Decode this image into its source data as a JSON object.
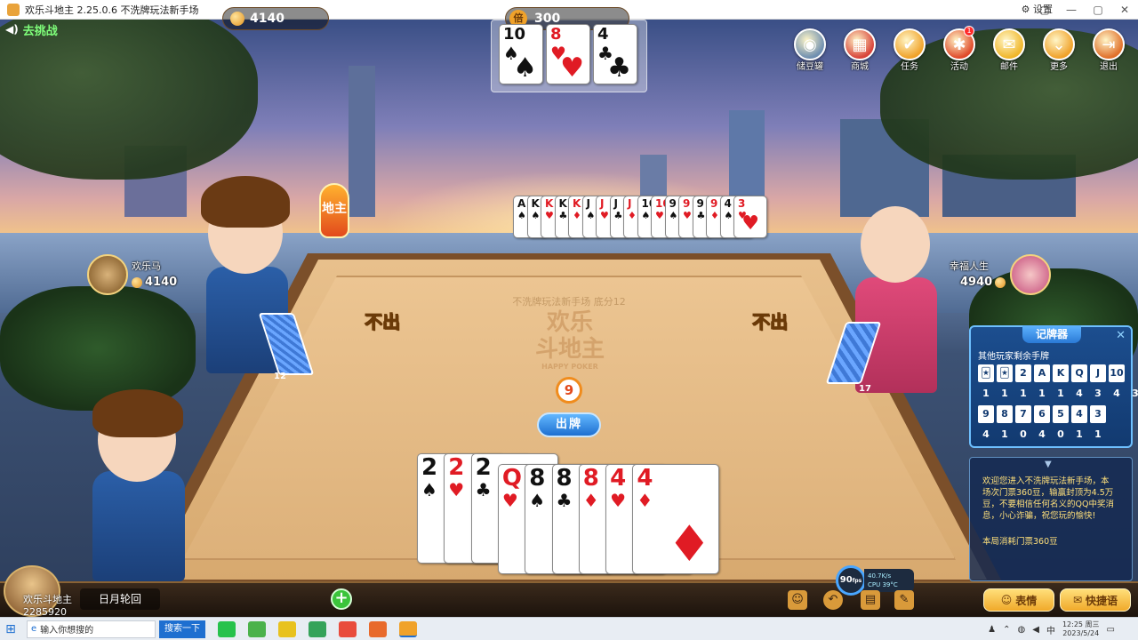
{
  "window": {
    "title": "欢乐斗地主 2.25.0.6 不洗牌玩法新手场",
    "settings_label": "设置",
    "controls": [
      "▢",
      "—",
      "▢",
      "✕"
    ]
  },
  "challenge": {
    "label": "去挑战"
  },
  "bottom_cards": [
    {
      "rank": "10",
      "suit": "♠",
      "color": "black"
    },
    {
      "rank": "8",
      "suit": "♥",
      "color": "red"
    },
    {
      "rank": "4",
      "suit": "♣",
      "color": "black"
    }
  ],
  "top_menu": [
    {
      "label": "储豆罐",
      "icon": "piggy-bank-icon",
      "color": "#6f8fb0",
      "glyph": "◉",
      "badge": ""
    },
    {
      "label": "商城",
      "icon": "shop-icon",
      "color": "#d8443a",
      "glyph": "▦",
      "badge": ""
    },
    {
      "label": "任务",
      "icon": "task-icon",
      "color": "#f0a22a",
      "glyph": "✔",
      "badge": ""
    },
    {
      "label": "活动",
      "icon": "gift-icon",
      "color": "#e04a2a",
      "glyph": "✱",
      "badge": "1"
    },
    {
      "label": "邮件",
      "icon": "mail-icon",
      "color": "#f0b62a",
      "glyph": "✉",
      "badge": ""
    },
    {
      "label": "更多",
      "icon": "more-icon",
      "color": "#f0a22a",
      "glyph": "⌄",
      "badge": ""
    },
    {
      "label": "退出",
      "icon": "exit-icon",
      "color": "#e0702a",
      "glyph": "⇥",
      "badge": ""
    }
  ],
  "left_player": {
    "name": "欢乐马",
    "beans": "4140",
    "card_count": "12",
    "action": "不出",
    "role": "地主"
  },
  "right_player": {
    "name": "幸福人生",
    "beans": "4940",
    "card_count": "17",
    "action": "不出"
  },
  "played_cards": [
    {
      "rank": "A",
      "suit": "♠",
      "color": "black"
    },
    {
      "rank": "K",
      "suit": "♠",
      "color": "black"
    },
    {
      "rank": "K",
      "suit": "♥",
      "color": "red"
    },
    {
      "rank": "K",
      "suit": "♣",
      "color": "black"
    },
    {
      "rank": "K",
      "suit": "♦",
      "color": "red"
    },
    {
      "rank": "J",
      "suit": "♠",
      "color": "black"
    },
    {
      "rank": "J",
      "suit": "♥",
      "color": "red"
    },
    {
      "rank": "J",
      "suit": "♣",
      "color": "black"
    },
    {
      "rank": "J",
      "suit": "♦",
      "color": "red"
    },
    {
      "rank": "10",
      "suit": "♠",
      "color": "black"
    },
    {
      "rank": "10",
      "suit": "♥",
      "color": "red"
    },
    {
      "rank": "9",
      "suit": "♠",
      "color": "black"
    },
    {
      "rank": "9",
      "suit": "♥",
      "color": "red"
    },
    {
      "rank": "9",
      "suit": "♣",
      "color": "black"
    },
    {
      "rank": "9",
      "suit": "♦",
      "color": "red"
    },
    {
      "rank": "4",
      "suit": "♠",
      "color": "black"
    },
    {
      "rank": "3",
      "suit": "♥",
      "color": "red"
    }
  ],
  "table": {
    "info": "不洗牌玩法新手场 底分12",
    "logo_line1": "欢乐",
    "logo_line2": "斗地主",
    "logo_sub": "HAPPY POKER"
  },
  "timer": "9",
  "play_button": "出牌",
  "hand_cards": [
    {
      "rank": "2",
      "suit": "♠",
      "color": "black"
    },
    {
      "rank": "2",
      "suit": "♥",
      "color": "red"
    },
    {
      "rank": "2",
      "suit": "♣",
      "color": "black"
    },
    {
      "rank": "Q",
      "suit": "♥",
      "color": "red"
    },
    {
      "rank": "8",
      "suit": "♠",
      "color": "black"
    },
    {
      "rank": "8",
      "suit": "♣",
      "color": "black"
    },
    {
      "rank": "8",
      "suit": "♦",
      "color": "red"
    },
    {
      "rank": "4",
      "suit": "♥",
      "color": "red"
    },
    {
      "rank": "4",
      "suit": "♦",
      "color": "red"
    }
  ],
  "card_memory": {
    "title": "记牌器",
    "subtitle": "其他玩家剩余手牌",
    "row1_labels": [
      "🃏",
      "🃏",
      "2",
      "A",
      "K",
      "Q",
      "J",
      "10"
    ],
    "row1_counts": [
      "1",
      "1",
      "1",
      "1",
      "1",
      "4",
      "3",
      "4",
      "3"
    ],
    "row2_labels": [
      "9",
      "8",
      "7",
      "6",
      "5",
      "4",
      "3"
    ],
    "row2_counts": [
      "4",
      "1",
      "0",
      "4",
      "0",
      "1",
      "1"
    ]
  },
  "system_message": {
    "text": "欢迎您进入不洗牌玩法新手场，本场次门票360豆，输赢封顶为4.5万豆，不要相信任何名义的QQ中奖消息，小心诈骗，祝您玩的愉快!",
    "fee": "本局消耗门票360豆"
  },
  "me": {
    "name": "欢乐斗地主",
    "id": "2285920",
    "rank": "日月轮回",
    "beans": "4140",
    "multiplier": "300",
    "multiplier_label": "倍"
  },
  "perf": {
    "fps": "90",
    "fps_unit": "fps",
    "net": "40.7K/s",
    "cpu": "CPU 39°C"
  },
  "buttons": {
    "emoji": "表情",
    "quick_chat": "快捷语"
  },
  "taskbar": {
    "search_placeholder": "输入你想搜的",
    "search_button": "搜索一下",
    "ime": "中",
    "time": "12:25 周三",
    "date": "2023/5/24"
  }
}
